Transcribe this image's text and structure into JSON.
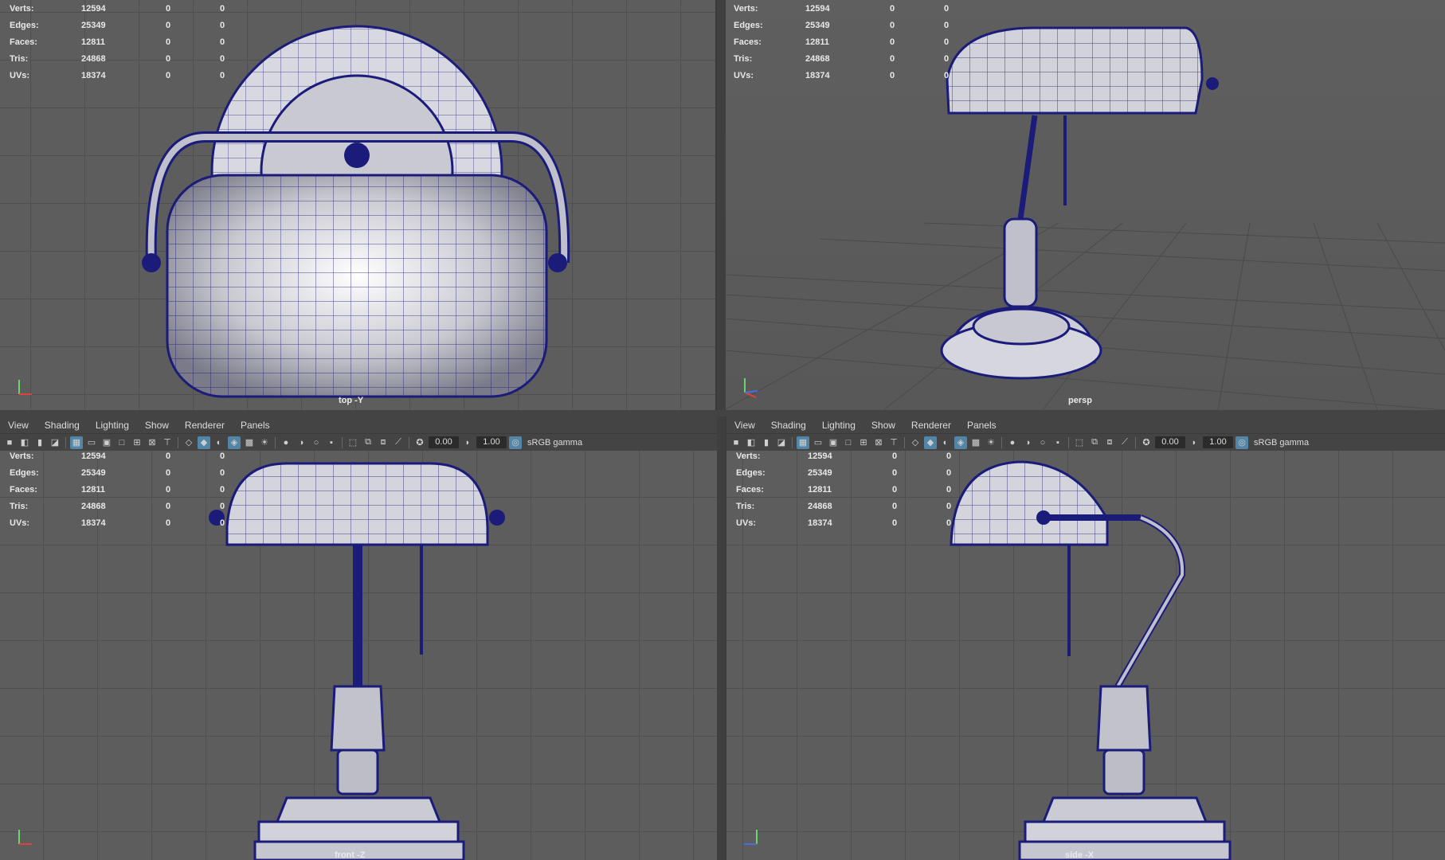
{
  "hud_stats": [
    {
      "label": "Verts:",
      "value": "12594",
      "a": "0",
      "b": "0"
    },
    {
      "label": "Edges:",
      "value": "25349",
      "a": "0",
      "b": "0"
    },
    {
      "label": "Faces:",
      "value": "12811",
      "a": "0",
      "b": "0"
    },
    {
      "label": "Tris:",
      "value": "24868",
      "a": "0",
      "b": "0"
    },
    {
      "label": "UVs:",
      "value": "18374",
      "a": "0",
      "b": "0"
    }
  ],
  "panels": {
    "top": {
      "camera": "top -Y"
    },
    "persp": {
      "camera": "persp"
    },
    "front": {
      "camera": "front -Z"
    },
    "side": {
      "camera": "side -X"
    }
  },
  "menu": {
    "items": [
      "View",
      "Shading",
      "Lighting",
      "Show",
      "Renderer",
      "Panels"
    ]
  },
  "toolbar": {
    "exposure": "0.00",
    "gamma": "1.00",
    "color_space": "sRGB gamma"
  },
  "colors": {
    "viewport_bg": "#5d5d5d",
    "grid": "#4f4f4f",
    "wireframe": "#1b1c7a",
    "active_icon": "#5285a6"
  },
  "icons": [
    "camera-icon",
    "camera-attr-icon",
    "bookmark-icon",
    "image-plane-icon",
    "grid-icon",
    "film-gate-icon",
    "resolution-gate-icon",
    "gate-mask-icon",
    "field-chart-icon",
    "safe-action-icon",
    "safe-title-icon",
    "wireframe-icon",
    "smooth-shade-icon",
    "default-material-icon",
    "wireframe-on-shaded-icon",
    "xray-icon",
    "use-lights-icon",
    "shadows-icon",
    "ssao-icon",
    "motion-blur-icon",
    "antialias-icon",
    "isolate-select-icon",
    "xray-joints-icon",
    "exposure-icon",
    "gamma-icon",
    "color-management-icon"
  ]
}
